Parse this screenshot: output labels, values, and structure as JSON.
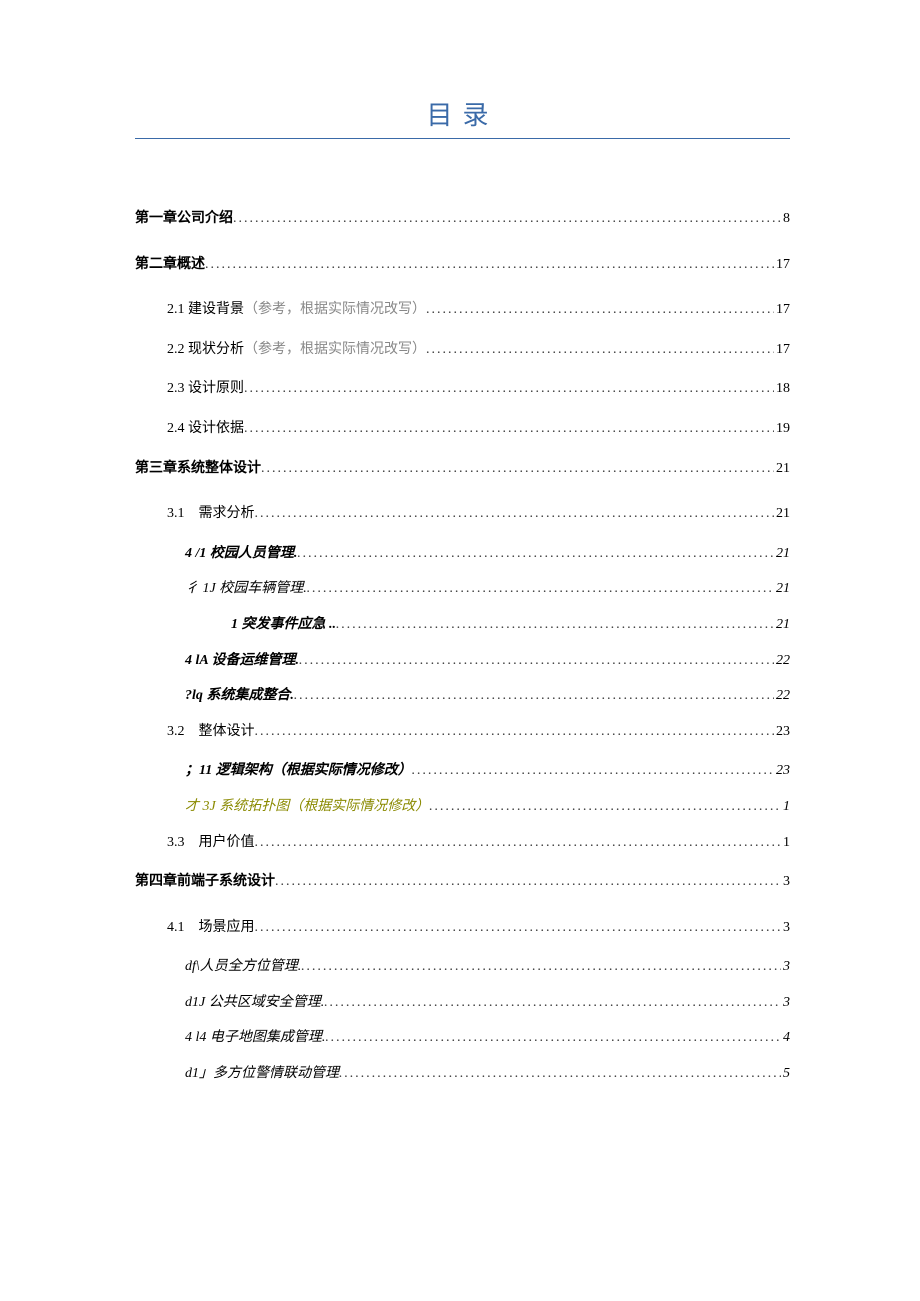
{
  "title": "目录",
  "entries": [
    {
      "level": 0,
      "label": "第一章公司介绍",
      "page": "8",
      "bold": true,
      "italic": false,
      "cls": ""
    },
    {
      "level": 0,
      "label": "第二章概述",
      "page": "17",
      "bold": true,
      "italic": false,
      "cls": ""
    },
    {
      "level": 1,
      "label": "2.1 建设背景（参考，根据实际情况改写）",
      "page": "17",
      "bold": false,
      "italic": false,
      "cls": "gray-note-partial"
    },
    {
      "level": 1,
      "label": "2.2 现状分析（参考，根据实际情况改写）",
      "page": "17",
      "bold": false,
      "italic": false,
      "cls": "gray-note-partial"
    },
    {
      "level": 1,
      "label": "2.3 设计原则",
      "page": "18",
      "bold": false,
      "italic": false,
      "cls": ""
    },
    {
      "level": 1,
      "label": "2.4 设计依据",
      "page": "19",
      "bold": false,
      "italic": false,
      "cls": ""
    },
    {
      "level": 0,
      "label": "第三章系统整体设计",
      "page": "21",
      "bold": true,
      "italic": false,
      "cls": ""
    },
    {
      "level": 1,
      "label": "3.1　需求分析",
      "page": "21",
      "bold": false,
      "italic": false,
      "cls": ""
    },
    {
      "level": 2,
      "label": "4 /1 校园人员管理.",
      "page": "21",
      "bold": true,
      "italic": true,
      "cls": ""
    },
    {
      "level": 2,
      "label": "彳 1J 校园车辆管理.",
      "page": "21",
      "bold": false,
      "italic": true,
      "cls": ""
    },
    {
      "level": 3,
      "label": "1 突发事件应急 ..",
      "page": "21",
      "bold": true,
      "italic": true,
      "cls": ""
    },
    {
      "level": 2,
      "label": "4 lA 设备运维管理.",
      "page": "22",
      "bold": true,
      "italic": true,
      "cls": ""
    },
    {
      "level": 2,
      "label": "?lq 系统集成整合.",
      "page": "22",
      "bold": true,
      "italic": true,
      "cls": ""
    },
    {
      "level": 1,
      "label": "3.2　整体设计",
      "page": "23",
      "bold": false,
      "italic": false,
      "cls": ""
    },
    {
      "level": 2,
      "label": "；11 逻辑架构（根据实际情况修改）",
      "page": "23",
      "bold": true,
      "italic": true,
      "cls": ""
    },
    {
      "level": 2,
      "label": "才 3J 系统拓扑图（根据实际情况修改）",
      "page": "1",
      "bold": false,
      "italic": true,
      "cls": "olive"
    },
    {
      "level": 1,
      "label": "3.3　用户价值",
      "page": "1",
      "bold": false,
      "italic": false,
      "cls": ""
    },
    {
      "level": 0,
      "label": "第四章前端子系统设计",
      "page": "3",
      "bold": true,
      "italic": false,
      "cls": ""
    },
    {
      "level": 1,
      "label": "4.1　场景应用",
      "page": "3",
      "bold": false,
      "italic": false,
      "cls": ""
    },
    {
      "level": 2,
      "label": "df\\人员全方位管理.",
      "page": "3",
      "bold": false,
      "italic": true,
      "cls": ""
    },
    {
      "level": 2,
      "label": "d1J 公共区域安全管理.",
      "page": "3",
      "bold": false,
      "italic": true,
      "cls": ""
    },
    {
      "level": 2,
      "label": "4 l4 电子地图集成管理.",
      "page": "4",
      "bold": false,
      "italic": true,
      "cls": ""
    },
    {
      "level": 2,
      "label": "d1」多方位警情联动管理",
      "page": "5",
      "bold": false,
      "italic": true,
      "cls": ""
    }
  ]
}
